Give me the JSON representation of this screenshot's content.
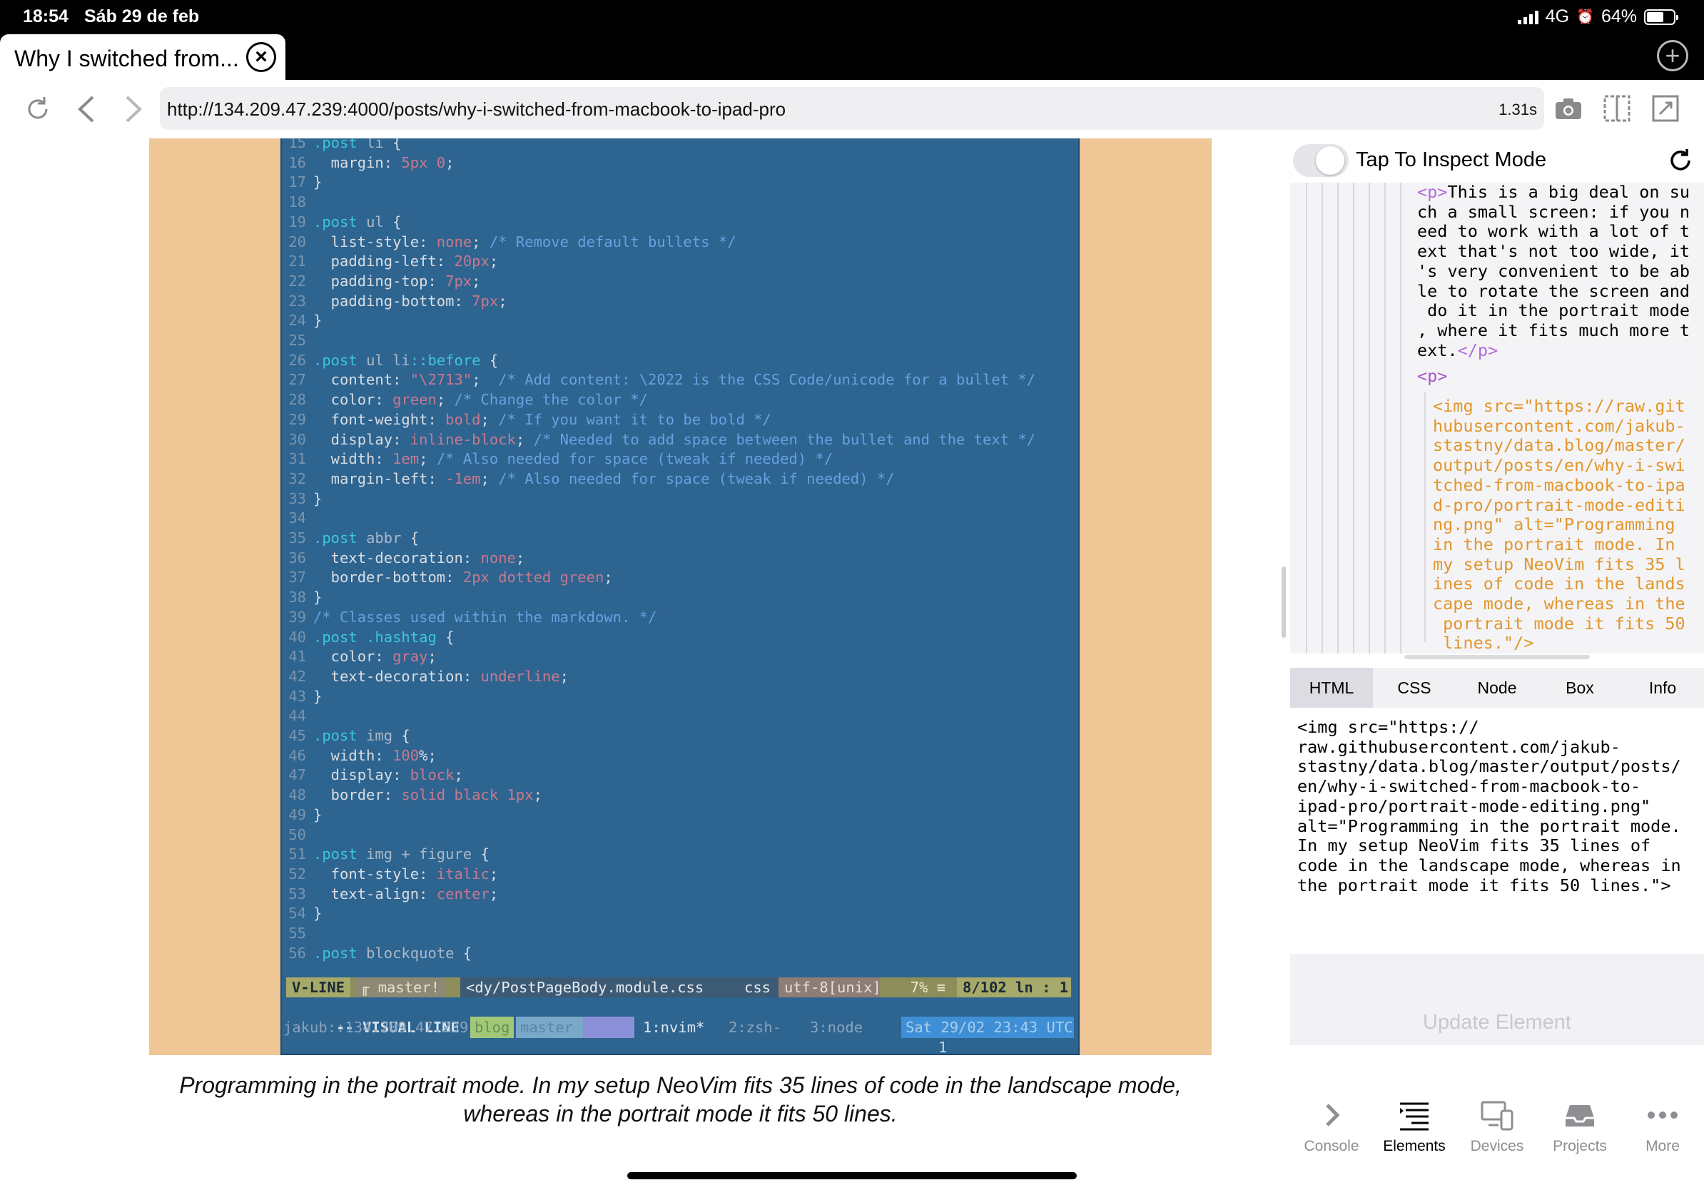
{
  "status_bar": {
    "time": "18:54",
    "date": "Sáb 29 de feb",
    "network": "4G",
    "battery": "64%",
    "battery_level": 0.64
  },
  "tab": {
    "title": "Why I switched from..."
  },
  "toolbar": {
    "url": "http://134.209.47.239:4000/posts/why-i-switched-from-macbook-to-ipad-pro",
    "load_time": "1.31s"
  },
  "editor": {
    "lines": [
      {
        "n": "15",
        "parts": [
          [
            ".post ",
            "kw"
          ],
          [
            "li",
            "sel"
          ],
          [
            " {",
            "pun"
          ]
        ]
      },
      {
        "n": "16",
        "parts": [
          [
            "  margin",
            "prop"
          ],
          [
            ": ",
            "pun"
          ],
          [
            "5px 0",
            "val"
          ],
          [
            ";",
            "pun"
          ]
        ]
      },
      {
        "n": "17",
        "parts": [
          [
            "}",
            "pun"
          ]
        ]
      },
      {
        "n": "18",
        "parts": []
      },
      {
        "n": "19",
        "parts": [
          [
            ".post ",
            "kw"
          ],
          [
            "ul",
            "sel"
          ],
          [
            " {",
            "pun"
          ]
        ]
      },
      {
        "n": "20",
        "parts": [
          [
            "  list-style",
            "prop"
          ],
          [
            ": ",
            "pun"
          ],
          [
            "none",
            "val"
          ],
          [
            "; ",
            "pun"
          ],
          [
            "/* Remove default bullets */",
            "cmt"
          ]
        ]
      },
      {
        "n": "21",
        "parts": [
          [
            "  padding-left",
            "prop"
          ],
          [
            ": ",
            "pun"
          ],
          [
            "20px",
            "val"
          ],
          [
            ";",
            "pun"
          ]
        ]
      },
      {
        "n": "22",
        "parts": [
          [
            "  padding-top",
            "prop"
          ],
          [
            ": ",
            "pun"
          ],
          [
            "7px",
            "val"
          ],
          [
            ";",
            "pun"
          ]
        ]
      },
      {
        "n": "23",
        "parts": [
          [
            "  padding-bottom",
            "prop"
          ],
          [
            ": ",
            "pun"
          ],
          [
            "7px",
            "val"
          ],
          [
            ";",
            "pun"
          ]
        ]
      },
      {
        "n": "24",
        "parts": [
          [
            "}",
            "pun"
          ]
        ]
      },
      {
        "n": "25",
        "parts": []
      },
      {
        "n": "26",
        "parts": [
          [
            ".post ",
            "kw"
          ],
          [
            "ul li",
            "sel"
          ],
          [
            "::before",
            "kw"
          ],
          [
            " {",
            "pun"
          ]
        ]
      },
      {
        "n": "27",
        "parts": [
          [
            "  content",
            "prop"
          ],
          [
            ": ",
            "pun"
          ],
          [
            "\"\\2713\"",
            "val"
          ],
          [
            ";  ",
            "pun"
          ],
          [
            "/* Add content: \\2022 is the CSS Code/unicode for a bullet */",
            "cmt"
          ]
        ]
      },
      {
        "n": "28",
        "parts": [
          [
            "  color",
            "prop"
          ],
          [
            ": ",
            "pun"
          ],
          [
            "green",
            "val"
          ],
          [
            "; ",
            "pun"
          ],
          [
            "/* Change the color */",
            "cmt"
          ]
        ]
      },
      {
        "n": "29",
        "parts": [
          [
            "  font-weight",
            "prop"
          ],
          [
            ": ",
            "pun"
          ],
          [
            "bold",
            "val"
          ],
          [
            "; ",
            "pun"
          ],
          [
            "/* If you want it to be bold */",
            "cmt"
          ]
        ]
      },
      {
        "n": "30",
        "parts": [
          [
            "  display",
            "prop"
          ],
          [
            ": ",
            "pun"
          ],
          [
            "inline-block",
            "val"
          ],
          [
            "; ",
            "pun"
          ],
          [
            "/* Needed to add space between the bullet and the text */",
            "cmt"
          ]
        ]
      },
      {
        "n": "31",
        "parts": [
          [
            "  width",
            "prop"
          ],
          [
            ": ",
            "pun"
          ],
          [
            "1em",
            "val"
          ],
          [
            "; ",
            "pun"
          ],
          [
            "/* Also needed for space (tweak if needed) */",
            "cmt"
          ]
        ]
      },
      {
        "n": "32",
        "parts": [
          [
            "  margin-left",
            "prop"
          ],
          [
            ": ",
            "pun"
          ],
          [
            "-1em",
            "val"
          ],
          [
            "; ",
            "pun"
          ],
          [
            "/* Also needed for space (tweak if needed) */",
            "cmt"
          ]
        ]
      },
      {
        "n": "33",
        "parts": [
          [
            "}",
            "pun"
          ]
        ]
      },
      {
        "n": "34",
        "parts": []
      },
      {
        "n": "35",
        "parts": [
          [
            ".post ",
            "kw"
          ],
          [
            "abbr",
            "sel"
          ],
          [
            " {",
            "pun"
          ]
        ]
      },
      {
        "n": "36",
        "parts": [
          [
            "  text-decoration",
            "prop"
          ],
          [
            ": ",
            "pun"
          ],
          [
            "none",
            "val"
          ],
          [
            ";",
            "pun"
          ]
        ]
      },
      {
        "n": "37",
        "parts": [
          [
            "  border-bottom",
            "prop"
          ],
          [
            ": ",
            "pun"
          ],
          [
            "2px dotted green",
            "val"
          ],
          [
            ";",
            "pun"
          ]
        ]
      },
      {
        "n": "38",
        "parts": [
          [
            "}",
            "pun"
          ]
        ]
      },
      {
        "n": "39",
        "parts": [
          [
            "/* Classes used within the markdown. */",
            "cmt"
          ]
        ]
      },
      {
        "n": "40",
        "parts": [
          [
            ".post .hashtag",
            "kw"
          ],
          [
            " {",
            "pun"
          ]
        ]
      },
      {
        "n": "41",
        "parts": [
          [
            "  color",
            "prop"
          ],
          [
            ": ",
            "pun"
          ],
          [
            "gray",
            "val"
          ],
          [
            ";",
            "pun"
          ]
        ]
      },
      {
        "n": "42",
        "parts": [
          [
            "  text-decoration",
            "prop"
          ],
          [
            ": ",
            "pun"
          ],
          [
            "underline",
            "val"
          ],
          [
            ";",
            "pun"
          ]
        ]
      },
      {
        "n": "43",
        "parts": [
          [
            "}",
            "pun"
          ]
        ]
      },
      {
        "n": "44",
        "parts": []
      },
      {
        "n": "45",
        "parts": [
          [
            ".post ",
            "kw"
          ],
          [
            "img",
            "sel"
          ],
          [
            " {",
            "pun"
          ]
        ]
      },
      {
        "n": "46",
        "parts": [
          [
            "  width",
            "prop"
          ],
          [
            ": ",
            "pun"
          ],
          [
            "100",
            "val"
          ],
          [
            "%;",
            "pun"
          ]
        ]
      },
      {
        "n": "47",
        "parts": [
          [
            "  display",
            "prop"
          ],
          [
            ": ",
            "pun"
          ],
          [
            "block",
            "val"
          ],
          [
            ";",
            "pun"
          ]
        ]
      },
      {
        "n": "48",
        "parts": [
          [
            "  border",
            "prop"
          ],
          [
            ": ",
            "pun"
          ],
          [
            "solid black 1px",
            "val"
          ],
          [
            ";",
            "pun"
          ]
        ]
      },
      {
        "n": "49",
        "parts": [
          [
            "}",
            "pun"
          ]
        ]
      },
      {
        "n": "50",
        "parts": []
      },
      {
        "n": "51",
        "parts": [
          [
            ".post ",
            "kw"
          ],
          [
            "img + figure",
            "sel"
          ],
          [
            " {",
            "pun"
          ]
        ]
      },
      {
        "n": "52",
        "parts": [
          [
            "  font-style",
            "prop"
          ],
          [
            ": ",
            "pun"
          ],
          [
            "italic",
            "val"
          ],
          [
            ";",
            "pun"
          ]
        ]
      },
      {
        "n": "53",
        "parts": [
          [
            "  text-align",
            "prop"
          ],
          [
            ": ",
            "pun"
          ],
          [
            "center",
            "val"
          ],
          [
            ";",
            "pun"
          ]
        ]
      },
      {
        "n": "54",
        "parts": [
          [
            "}",
            "pun"
          ]
        ]
      },
      {
        "n": "55",
        "parts": []
      },
      {
        "n": "56",
        "parts": [
          [
            ".post ",
            "kw"
          ],
          [
            "blockquote",
            "sel"
          ],
          [
            " {",
            "pun"
          ]
        ]
      }
    ],
    "statusline": {
      "mode": "V-LINE",
      "branch": "master!",
      "file": "<dy/PostPageBody.module.css",
      "filetype": "css",
      "encoding": "utf-8[unix]",
      "percent": "7% ≡",
      "position": "8/102",
      "ln": "ln :",
      "col": "1"
    },
    "modeline": "-- VISUAL LINE --",
    "modeline_count": "1",
    "tmux": {
      "host": "jakub::134.209.47.239",
      "session": "blog",
      "branch": "master",
      "win1": "1:nvim*",
      "win2": "2:zsh-",
      "win3": "3:node",
      "clock": "Sat 29/02 23:43 UTC"
    }
  },
  "caption": "Programming in the portrait mode. In my setup NeoVim fits 35 lines of code in the landscape mode, whereas in the portrait mode it fits 50 lines.",
  "inspector": {
    "toggle_label": "Tap To Inspect Mode",
    "dom_p_open": "<p>",
    "dom_p_text": "This is a big deal on su\nch a small screen: if you n\need to work with a lot of t\next that's not too wide, it\n's very convenient to be ab\nle to rotate the screen and\n do it in the portrait mode\n, where it fits much more t\next.",
    "dom_p_close": "</p>",
    "dom_p2": "<p>",
    "dom_img": "<img src=\"https://raw.git\nhubusercontent.com/jakub-\nstastny/data.blog/master/\noutput/posts/en/why-i-swi\ntched-from-macbook-to-ipa\nd-pro/portrait-mode-editi\nng.png\" alt=\"Programming\nin the portrait mode. In\nmy setup NeoVim fits 35 l\nines of code in the lands\ncape mode, whereas in the\n portrait mode it fits 50\n lines.\"/>",
    "tabs": [
      "HTML",
      "CSS",
      "Node",
      "Box",
      "Info"
    ],
    "active_tab": "HTML",
    "element_source": "<img src=\"https://\nraw.githubusercontent.com/jakub-\nstastny/data.blog/master/output/posts/\nen/why-i-switched-from-macbook-to-\nipad-pro/portrait-mode-editing.png\"\nalt=\"Programming in the portrait mode.\nIn my setup NeoVim fits 35 lines of\ncode in the landscape mode, whereas in\nthe portrait mode it fits 50 lines.\">",
    "update_label": "Update Element",
    "bottom_nav": [
      {
        "label": "Console",
        "icon": "chevron-right-icon"
      },
      {
        "label": "Elements",
        "icon": "elements-list-icon"
      },
      {
        "label": "Devices",
        "icon": "devices-icon"
      },
      {
        "label": "Projects",
        "icon": "inbox-tray-icon"
      },
      {
        "label": "More",
        "icon": "ellipsis-icon"
      }
    ],
    "active_nav": "Elements"
  },
  "colors": {
    "terminal_bg": "#2e6490",
    "frame_bg": "#efc696",
    "keyword": "#3dc7d8",
    "value": "#c6798f",
    "comment": "#67a1e0"
  }
}
